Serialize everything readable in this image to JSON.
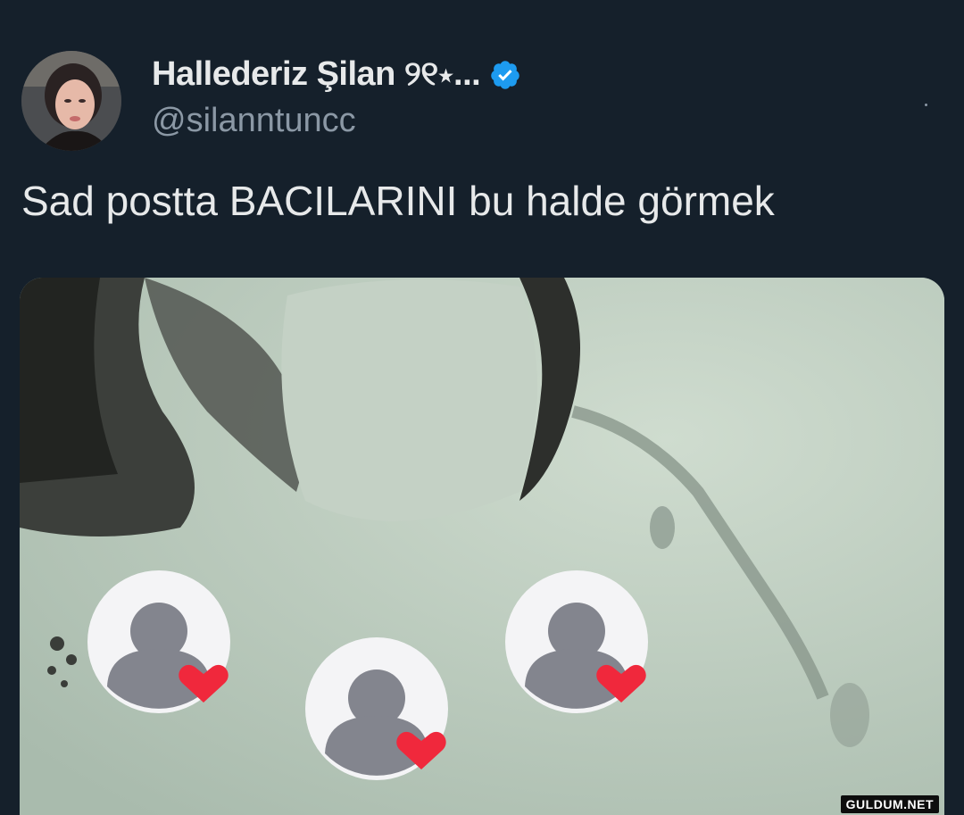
{
  "tweet": {
    "display_name": "Hallederiz Şilan ୨୧⋆...",
    "handle": "@silanntuncc",
    "text": "Sad postta BACILARINI bu halde görmek",
    "verified": true
  },
  "media": {
    "watermark": "GULDUM.NET",
    "overlay_icons": [
      "profile-placeholder-heart",
      "profile-placeholder-heart",
      "profile-placeholder-heart"
    ]
  },
  "colors": {
    "background": "#15202b",
    "verified_badge": "#1d9bf0",
    "heart": "#f0283c"
  }
}
